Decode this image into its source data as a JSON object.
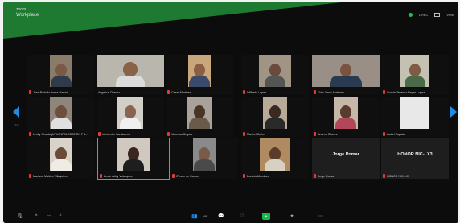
{
  "app": {
    "brand": "zoom",
    "title": "Workplace",
    "status_text": "1 REC",
    "view_label": "View"
  },
  "pagination": {
    "left_label": "1/3"
  },
  "participants": [
    {
      "name": "Jose Rodolfo Ibarra Garcia",
      "muted": true
    },
    {
      "name": "Angelica Chavez",
      "muted": false
    },
    {
      "name": "Cesar Martinez",
      "muted": true
    },
    {
      "name": "Wilfredo Lopez",
      "muted": true
    },
    {
      "name": "Odin Jesus Martinez",
      "muted": true
    },
    {
      "name": "Yuncia Jimenez Reyes Lopez",
      "muted": true
    },
    {
      "name": "Lesby Pineda (UTH/INFOLOCATION F 1...",
      "muted": true
    },
    {
      "name": "Venturelle Saraluzemi",
      "muted": true
    },
    {
      "name": "Vanessa Segura",
      "muted": true
    },
    {
      "name": "Maricel Cortes",
      "muted": true
    },
    {
      "name": "Andrea Chavez",
      "muted": true
    },
    {
      "name": "Isabel Zapata",
      "muted": true
    },
    {
      "name": "Mariana Maldes Villaquiren",
      "muted": true
    },
    {
      "name": "Leslie Abby Velazquez",
      "muted": true
    },
    {
      "name": "iPhone de Carlos",
      "muted": true
    },
    {
      "name": "Daniela Mendoza",
      "muted": true
    },
    {
      "name": "Jorge Pomar",
      "muted": true
    },
    {
      "name": "HONOR NIC-LX3",
      "muted": true
    }
  ],
  "name_tiles": [
    {
      "display": "Jorge Pomar",
      "label": "Jorge Pomar"
    },
    {
      "display": "HONOR NIC-LX3",
      "label": "HONOR NIC-LX3"
    }
  ],
  "toolbar": {
    "mute_icon": "microphone-icon",
    "video_icon": "camera-icon",
    "participants_count": "48",
    "participants_icon": "people-icon",
    "share_icon": "share-screen-icon",
    "chat_icon": "chat-icon",
    "reactions_icon": "reactions-icon",
    "more_icon": "more-icon"
  },
  "colors": {
    "accent_green": "#19b84a",
    "brand_green": "#1e7a31",
    "arrow_blue": "#1f8be3",
    "muted_red": "#e23b3b"
  }
}
